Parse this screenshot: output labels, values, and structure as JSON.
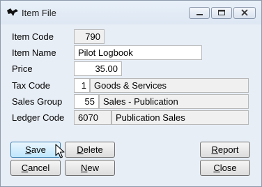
{
  "window": {
    "title": "Item File",
    "icons": {
      "app": "bird-icon",
      "minimize": "minimize-icon",
      "maximize": "maximize-icon",
      "close": "close-icon"
    }
  },
  "form": {
    "item_code": {
      "label": "Item Code",
      "value": "790"
    },
    "item_name": {
      "label": "Item Name",
      "value": "Pilot Logbook"
    },
    "price": {
      "label": "Price",
      "value": "35.00"
    },
    "tax_code": {
      "label": "Tax Code",
      "code": "1",
      "description": "Goods & Services"
    },
    "sales_group": {
      "label": "Sales Group",
      "code": "55",
      "description": "Sales - Publication"
    },
    "ledger_code": {
      "label": "Ledger Code",
      "code": "6070",
      "description": "Publication Sales"
    }
  },
  "buttons": {
    "save": {
      "mnemonic": "S",
      "rest": "ave"
    },
    "delete": {
      "mnemonic": "D",
      "rest": "elete"
    },
    "report": {
      "mnemonic": "R",
      "rest": "eport"
    },
    "cancel": {
      "mnemonic": "C",
      "rest": "ancel"
    },
    "new": {
      "mnemonic": "N",
      "rest": "ew"
    },
    "close": {
      "mnemonic": "C",
      "rest": "lose"
    }
  },
  "colors": {
    "accent": "#3c7fb1",
    "window_frame": "#8c99aa",
    "window_bg": "#e8eef6",
    "client_bg": "#f0f0f0"
  }
}
